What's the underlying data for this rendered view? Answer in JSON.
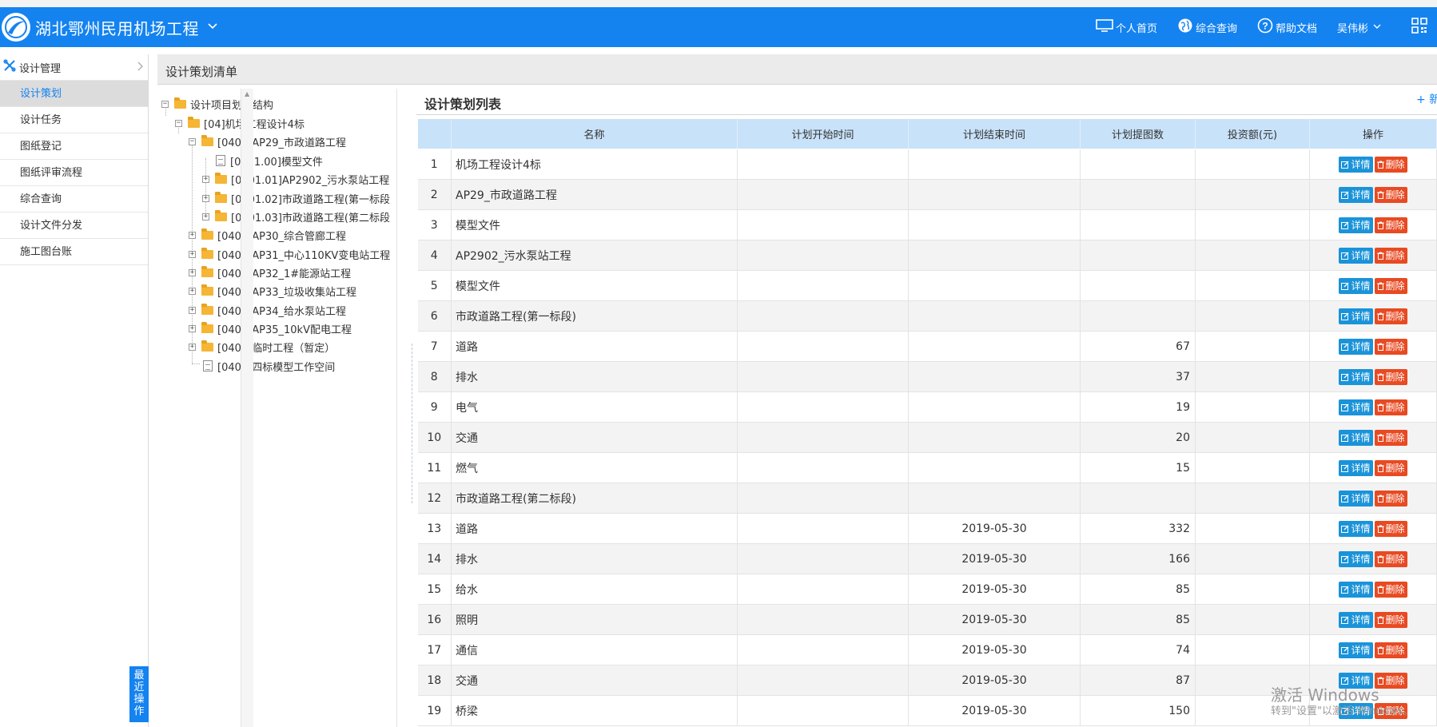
{
  "header": {
    "app_title": "湖北鄂州民用机场工程",
    "nav": {
      "home": "个人首页",
      "query": "综合查询",
      "help": "帮助文档"
    },
    "user": "吴伟彬"
  },
  "sidebar": {
    "section_label": "设计管理",
    "items": [
      {
        "label": "设计策划",
        "active": true
      },
      {
        "label": "设计任务"
      },
      {
        "label": "图纸登记"
      },
      {
        "label": "图纸评审流程"
      },
      {
        "label": "综合查询"
      },
      {
        "label": "设计文件分发"
      },
      {
        "label": "施工图台账"
      }
    ],
    "recent_ops": "最近操作"
  },
  "page": {
    "title": "设计策划清单"
  },
  "tree": {
    "root": "设计项目划分结构",
    "nodes": [
      {
        "label": "[04]机场工程设计4标"
      },
      {
        "label": "[0401]AP29_市政道路工程"
      },
      {
        "label": "[0401.00]模型文件"
      },
      {
        "label": "[0401.01]AP2902_污水泵站工程"
      },
      {
        "label": "[0401.02]市政道路工程(第一标段"
      },
      {
        "label": "[0401.03]市政道路工程(第二标段"
      },
      {
        "label": "[0402]AP30_综合管廊工程"
      },
      {
        "label": "[0403]AP31_中心110KV变电站工程"
      },
      {
        "label": "[0404]AP32_1#能源站工程"
      },
      {
        "label": "[0405]AP33_垃圾收集站工程"
      },
      {
        "label": "[0406]AP34_给水泵站工程"
      },
      {
        "label": "[0407]AP35_10kV配电工程"
      },
      {
        "label": "[0408]临时工程（暂定）"
      },
      {
        "label": "[0400]四标模型工作空间"
      }
    ]
  },
  "list": {
    "title": "设计策划列表",
    "add_label": "+ 新",
    "columns": [
      "名称",
      "计划开始时间",
      "计划结束时间",
      "计划提图数",
      "投资额(元)",
      "操作"
    ],
    "detail_label": "详情",
    "delete_label": "删除",
    "rows": [
      {
        "idx": "1",
        "name": "机场工程设计4标",
        "start": "",
        "end": "",
        "count": "",
        "invest": ""
      },
      {
        "idx": "2",
        "name": "AP29_市政道路工程",
        "start": "",
        "end": "",
        "count": "",
        "invest": ""
      },
      {
        "idx": "3",
        "name": "模型文件",
        "start": "",
        "end": "",
        "count": "",
        "invest": ""
      },
      {
        "idx": "4",
        "name": "AP2902_污水泵站工程",
        "start": "",
        "end": "",
        "count": "",
        "invest": ""
      },
      {
        "idx": "5",
        "name": "模型文件",
        "start": "",
        "end": "",
        "count": "",
        "invest": ""
      },
      {
        "idx": "6",
        "name": "市政道路工程(第一标段)",
        "start": "",
        "end": "",
        "count": "",
        "invest": ""
      },
      {
        "idx": "7",
        "name": "道路",
        "start": "",
        "end": "",
        "count": "67",
        "invest": ""
      },
      {
        "idx": "8",
        "name": "排水",
        "start": "",
        "end": "",
        "count": "37",
        "invest": ""
      },
      {
        "idx": "9",
        "name": "电气",
        "start": "",
        "end": "",
        "count": "19",
        "invest": ""
      },
      {
        "idx": "10",
        "name": "交通",
        "start": "",
        "end": "",
        "count": "20",
        "invest": ""
      },
      {
        "idx": "11",
        "name": "燃气",
        "start": "",
        "end": "",
        "count": "15",
        "invest": ""
      },
      {
        "idx": "12",
        "name": "市政道路工程(第二标段)",
        "start": "",
        "end": "",
        "count": "",
        "invest": ""
      },
      {
        "idx": "13",
        "name": "道路",
        "start": "",
        "end": "2019-05-30",
        "count": "332",
        "invest": ""
      },
      {
        "idx": "14",
        "name": "排水",
        "start": "",
        "end": "2019-05-30",
        "count": "166",
        "invest": ""
      },
      {
        "idx": "15",
        "name": "给水",
        "start": "",
        "end": "2019-05-30",
        "count": "85",
        "invest": ""
      },
      {
        "idx": "16",
        "name": "照明",
        "start": "",
        "end": "2019-05-30",
        "count": "85",
        "invest": ""
      },
      {
        "idx": "17",
        "name": "通信",
        "start": "",
        "end": "2019-05-30",
        "count": "74",
        "invest": ""
      },
      {
        "idx": "18",
        "name": "交通",
        "start": "",
        "end": "2019-05-30",
        "count": "87",
        "invest": ""
      },
      {
        "idx": "19",
        "name": "桥梁",
        "start": "",
        "end": "2019-05-30",
        "count": "150",
        "invest": ""
      }
    ]
  },
  "watermark": {
    "line1": "激活 Windows",
    "line2": "转到\"设置\"以激活 Windows。"
  },
  "colors": {
    "brand": "#1483f0",
    "detail_button": "#1a93d9",
    "delete_button": "#e84a22",
    "table_header": "#c8e2f9"
  }
}
